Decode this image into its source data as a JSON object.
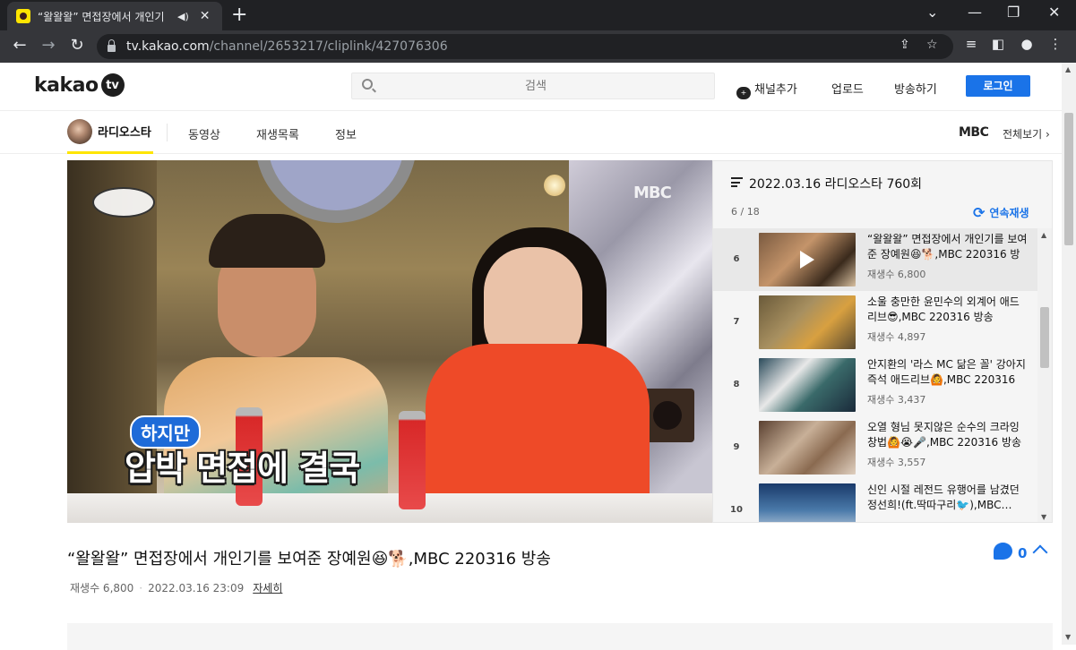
{
  "browser": {
    "tab_title": "“왈왈왈” 면접장에서 개인기",
    "url_host": "tv.kakao.com",
    "url_path": "/channel/2653217/cliplink/427076306"
  },
  "header": {
    "logo_text": "kakao",
    "logo_tv": "tv",
    "search_placeholder": "검색",
    "links": {
      "add_channel": "채널추가",
      "upload": "업로드",
      "broadcast": "방송하기",
      "login": "로그인"
    }
  },
  "channel_nav": {
    "channel_name": "라디오스타",
    "tabs": [
      "동영상",
      "재생목록",
      "정보"
    ],
    "broadcaster": "MBC",
    "see_all": "전체보기 ›"
  },
  "player": {
    "watermark": "MBC",
    "caption_sub": "하지만",
    "caption_main": "압박 면접에 결국"
  },
  "playlist": {
    "title": "2022.03.16 라디오스타 760회",
    "count": "6 / 18",
    "autoplay_label": "연속재생",
    "items": [
      {
        "num": "6",
        "title": "“왈왈왈” 면접장에서 개인기를 보여준 장예원😆🐕,MBC 220316 방송",
        "views": "재생수 6,800",
        "active": true
      },
      {
        "num": "7",
        "title": "소울 충만한 윤민수의 외계어 애드리브😎,MBC 220316 방송",
        "views": "재생수 4,897",
        "active": false
      },
      {
        "num": "8",
        "title": "안지환의 '라스 MC 닮은 꼴' 강아지 즉석 애드리브🙆,MBC 220316 …",
        "views": "재생수 3,437",
        "active": false
      },
      {
        "num": "9",
        "title": "오열 형님 못지않은 순수의 크라잉 창법🙆😭🎤,MBC 220316 방송",
        "views": "재생수 3,557",
        "active": false
      },
      {
        "num": "10",
        "title": "신인 시절 레전드 유행어를 남겼던 정선희!(ft.딱따구리🐦),MBC…",
        "views": "",
        "active": false
      }
    ]
  },
  "video": {
    "title": "“왈왈왈” 면접장에서 개인기를 보여준 장예원😆🐕,MBC 220316 방송",
    "comment_count": "0",
    "views": "재생수 6,800",
    "date": "2022.03.16 23:09",
    "detail_link": "자세히"
  },
  "colors": {
    "accent_blue": "#1a73e8",
    "kakao_yellow": "#fee500",
    "chrome_dark": "#202124"
  }
}
